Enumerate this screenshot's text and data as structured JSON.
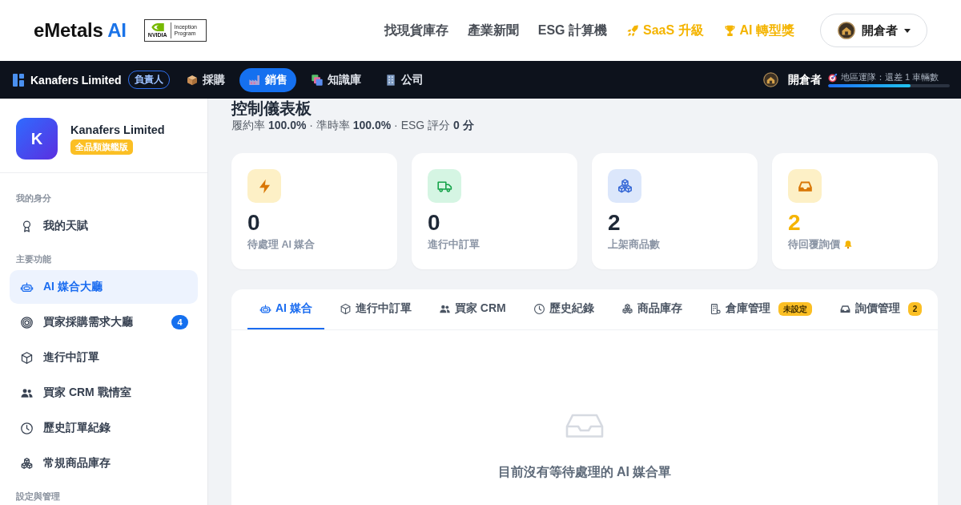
{
  "header": {
    "logo": {
      "text": "eMetals",
      "accent": "AI"
    },
    "partner_badge": {
      "wordmark": "NVIDIA",
      "label": "Inception Program"
    },
    "nav": [
      {
        "label": "找現貨庫存",
        "kind": "link"
      },
      {
        "label": "產業新聞",
        "kind": "link"
      },
      {
        "label": "ESG 計算機",
        "kind": "link"
      },
      {
        "label": "SaaS 升級",
        "kind": "rocket"
      },
      {
        "label": "AI 轉型獎",
        "kind": "trophy"
      }
    ],
    "account": {
      "label": "開倉者"
    }
  },
  "workspace_bar": {
    "org": {
      "name": "Kanafers Limited",
      "role": "負責人"
    },
    "modules": [
      {
        "label": "採購",
        "kind": "package",
        "selected": false
      },
      {
        "label": "銷售",
        "kind": "factory",
        "selected": true
      },
      {
        "label": "知識庫",
        "kind": "books",
        "selected": false
      },
      {
        "label": "公司",
        "kind": "office",
        "selected": false
      }
    ],
    "user": {
      "name": "開倉者"
    },
    "mission": {
      "text": "地區運隊：還差 1 車輛數",
      "level": 0.68
    }
  },
  "sidebar": {
    "company": {
      "initial": "K",
      "name": "Kanafers Limited",
      "plan": "全品類旗艦版"
    },
    "sections": [
      {
        "title": "我的身分",
        "items": [
          {
            "label": "我的天賦",
            "kind": "medal",
            "selected": false
          }
        ]
      },
      {
        "title": "主要功能",
        "items": [
          {
            "label": "AI 媒合大廳",
            "kind": "robot",
            "selected": true
          },
          {
            "label": "買家採購需求大廳",
            "kind": "target",
            "selected": false,
            "badge": "4"
          },
          {
            "label": "進行中訂單",
            "kind": "box",
            "selected": false
          },
          {
            "label": "買家 CRM 戰情室",
            "kind": "users",
            "selected": false
          },
          {
            "label": "歷史訂單紀錄",
            "kind": "clock",
            "selected": false
          },
          {
            "label": "常規商品庫存",
            "kind": "cubes",
            "selected": false
          }
        ]
      },
      {
        "title": "設定與管理"
      }
    ]
  },
  "dashboard": {
    "title": "控制儀表板",
    "summary": "履約率 **100.0%** · 準時率 **100.0%** · ESG 評分 **0 分**",
    "stats": [
      {
        "value": "0",
        "label": "待處理 AI 媒合",
        "kind": "bolt",
        "highlighted": false
      },
      {
        "value": "0",
        "label": "進行中訂單",
        "kind": "truck",
        "highlighted": false
      },
      {
        "value": "2",
        "label": "上架商品數",
        "kind": "cubes",
        "highlighted": false
      },
      {
        "value": "2",
        "label": "待回覆詢價",
        "kind": "inbox",
        "highlighted": true
      }
    ],
    "tabs": [
      {
        "label": "AI 媒合",
        "kind": "robot",
        "selected": true
      },
      {
        "label": "進行中訂單",
        "kind": "box",
        "selected": false
      },
      {
        "label": "買家 CRM",
        "kind": "users",
        "selected": false
      },
      {
        "label": "歷史紀錄",
        "kind": "clock",
        "selected": false
      },
      {
        "label": "商品庫存",
        "kind": "cubes",
        "selected": false
      },
      {
        "label": "倉庫管理",
        "kind": "building",
        "selected": false,
        "badge": "未設定"
      },
      {
        "label": "詢價管理",
        "kind": "inbox",
        "selected": false,
        "badge": "2"
      }
    ],
    "empty_state": {
      "message": "目前沒有等待處理的 AI 媒合單"
    }
  }
}
